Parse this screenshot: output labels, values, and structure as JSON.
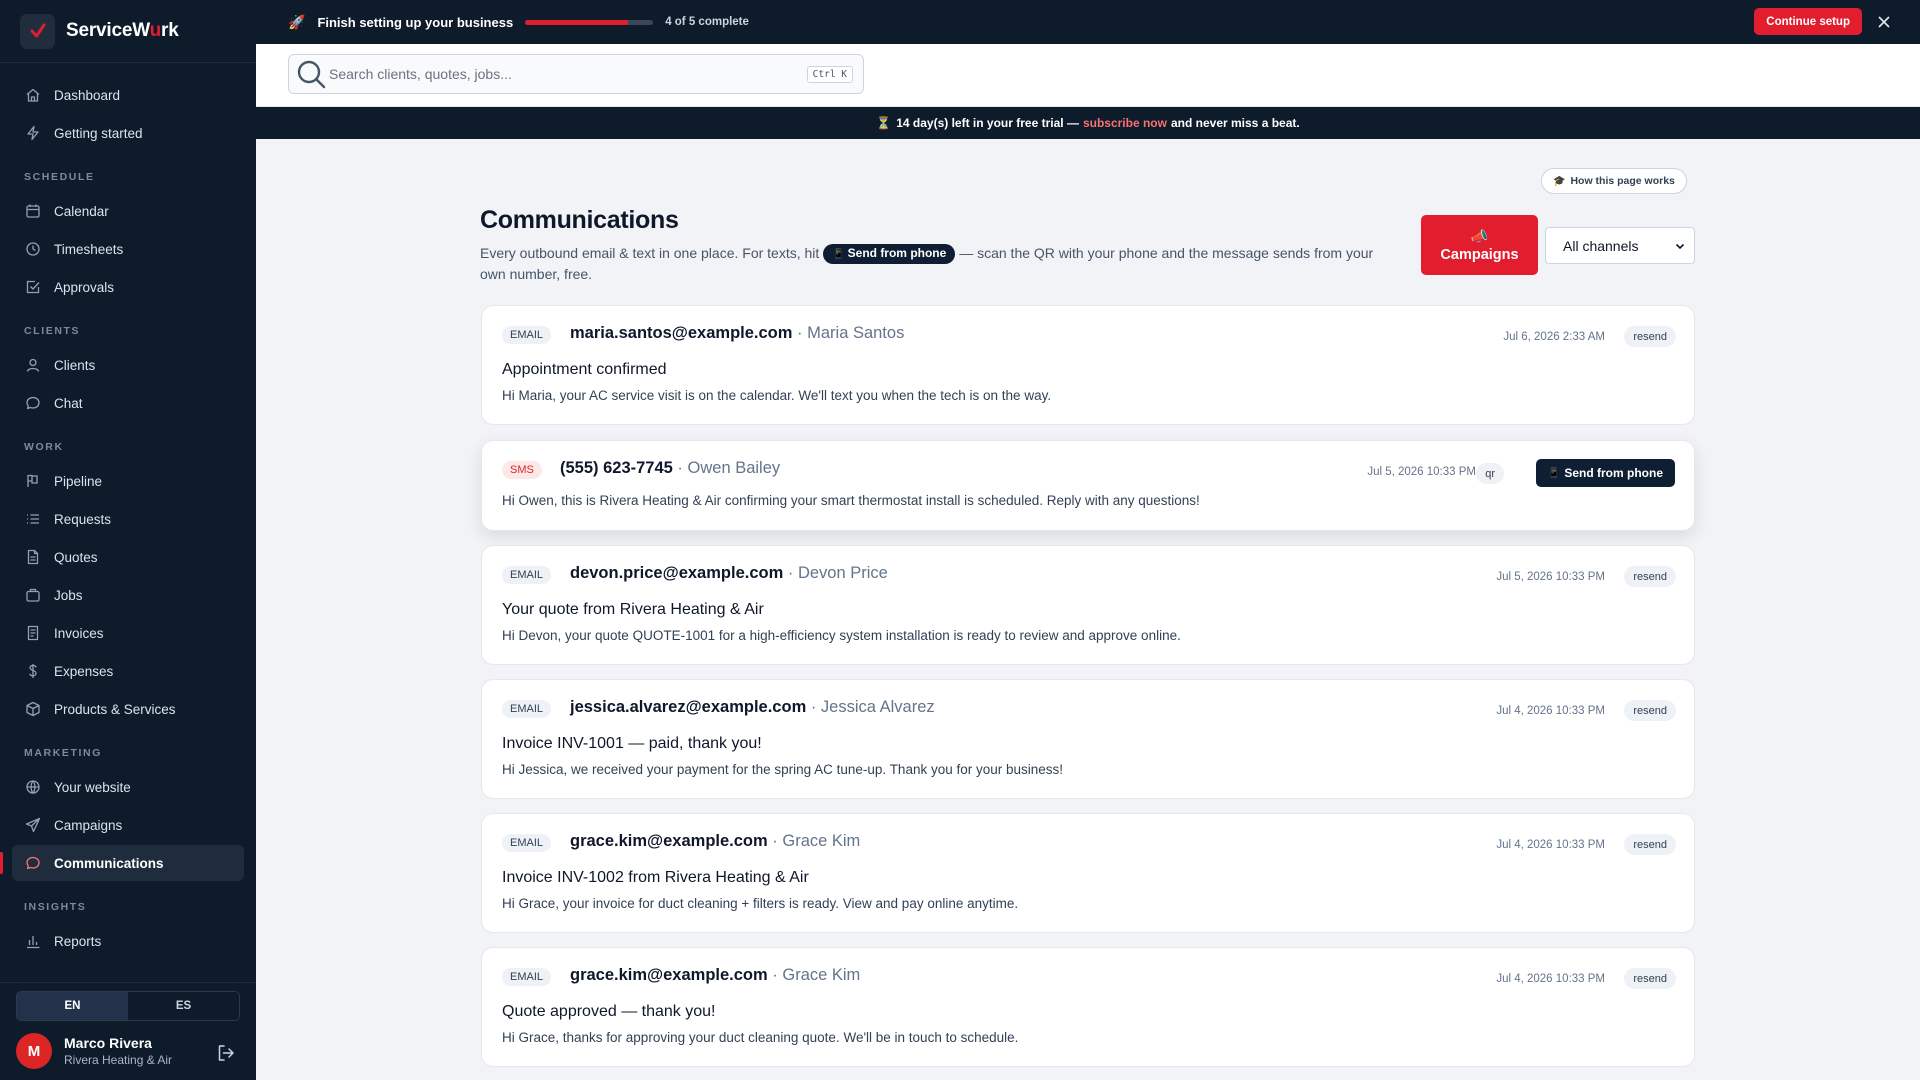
{
  "brand": {
    "name_prefix": "ServiceW",
    "name_highlight": "u",
    "name_suffix": "rk"
  },
  "sidebar": {
    "top_items": [
      {
        "label": "Dashboard",
        "icon": "home-icon"
      },
      {
        "label": "Getting started",
        "icon": "bolt-icon"
      }
    ],
    "sections": [
      {
        "title": "SCHEDULE",
        "items": [
          {
            "label": "Calendar",
            "icon": "calendar-icon"
          },
          {
            "label": "Timesheets",
            "icon": "clock-icon"
          },
          {
            "label": "Approvals",
            "icon": "check-square-icon"
          }
        ]
      },
      {
        "title": "CLIENTS",
        "items": [
          {
            "label": "Clients",
            "icon": "user-icon"
          },
          {
            "label": "Chat",
            "icon": "chat-icon"
          }
        ]
      },
      {
        "title": "WORK",
        "items": [
          {
            "label": "Pipeline",
            "icon": "pipeline-icon"
          },
          {
            "label": "Requests",
            "icon": "list-icon"
          },
          {
            "label": "Quotes",
            "icon": "document-icon"
          },
          {
            "label": "Jobs",
            "icon": "briefcase-icon"
          },
          {
            "label": "Invoices",
            "icon": "invoice-icon"
          },
          {
            "label": "Expenses",
            "icon": "dollar-icon"
          },
          {
            "label": "Products & Services",
            "icon": "box-icon"
          }
        ]
      },
      {
        "title": "MARKETING",
        "items": [
          {
            "label": "Your website",
            "icon": "globe-icon"
          },
          {
            "label": "Campaigns",
            "icon": "send-icon"
          },
          {
            "label": "Communications",
            "icon": "message-icon",
            "active": true
          }
        ]
      },
      {
        "title": "INSIGHTS",
        "items": [
          {
            "label": "Reports",
            "icon": "bar-chart-icon"
          }
        ]
      }
    ],
    "languages": [
      "EN",
      "ES"
    ],
    "active_language": "EN",
    "user": {
      "initial": "M",
      "name": "Marco Rivera",
      "company": "Rivera Heating & Air"
    }
  },
  "setup": {
    "title": "Finish setting up your business",
    "progress": 0.8,
    "count_text": "4 of 5 complete",
    "continue_label": "Continue setup"
  },
  "search": {
    "placeholder": "Search clients, quotes, jobs...",
    "shortcut": "Ctrl K"
  },
  "trial": {
    "prefix": "14 day(s) left in your free trial —",
    "link": "subscribe now",
    "suffix": "and never miss a beat."
  },
  "main": {
    "help_label": "How this page works",
    "title": "Communications",
    "desc_before": "Every outbound email & text in one place. For texts, hit",
    "desc_pill": "Send from phone",
    "desc_after": "— scan the QR with your phone and the message sends from your own number, free.",
    "campaigns_label": "Campaigns",
    "channel_filter": "All channels"
  },
  "messages": [
    {
      "type": "EMAIL",
      "to": "maria.santos@example.com",
      "name": "Maria Santos",
      "time": "Jul 6, 2026 2:33 AM",
      "subject": "Appointment confirmed",
      "body": "Hi Maria, your AC service visit is on the calendar. We'll text you when the tech is on the way.",
      "action": "resend"
    },
    {
      "type": "SMS",
      "to": "(555) 623-7745",
      "name": "Owen Bailey",
      "time": "Jul 5, 2026 10:33 PM",
      "body": "Hi Owen, this is Rivera Heating & Air confirming your smart thermostat install is scheduled. Reply with any questions!",
      "qr_label": "qr",
      "action": "Send from phone"
    },
    {
      "type": "EMAIL",
      "to": "devon.price@example.com",
      "name": "Devon Price",
      "time": "Jul 5, 2026 10:33 PM",
      "subject": "Your quote from Rivera Heating & Air",
      "body": "Hi Devon, your quote QUOTE-1001 for a high-efficiency system installation is ready to review and approve online.",
      "action": "resend"
    },
    {
      "type": "EMAIL",
      "to": "jessica.alvarez@example.com",
      "name": "Jessica Alvarez",
      "time": "Jul 4, 2026 10:33 PM",
      "subject": "Invoice INV-1001 — paid, thank you!",
      "body": "Hi Jessica, we received your payment for the spring AC tune-up. Thank you for your business!",
      "action": "resend"
    },
    {
      "type": "EMAIL",
      "to": "grace.kim@example.com",
      "name": "Grace Kim",
      "time": "Jul 4, 2026 10:33 PM",
      "subject": "Invoice INV-1002 from Rivera Heating & Air",
      "body": "Hi Grace, your invoice for duct cleaning + filters is ready. View and pay online anytime.",
      "action": "resend"
    },
    {
      "type": "EMAIL",
      "to": "grace.kim@example.com",
      "name": "Grace Kim",
      "time": "Jul 4, 2026 10:33 PM",
      "subject": "Quote approved — thank you!",
      "body": "Hi Grace, thanks for approving your duct cleaning quote. We'll be in touch to schedule.",
      "action": "resend"
    }
  ],
  "colors": {
    "accent": "#e11d2e",
    "navy": "#0d1b2a"
  }
}
